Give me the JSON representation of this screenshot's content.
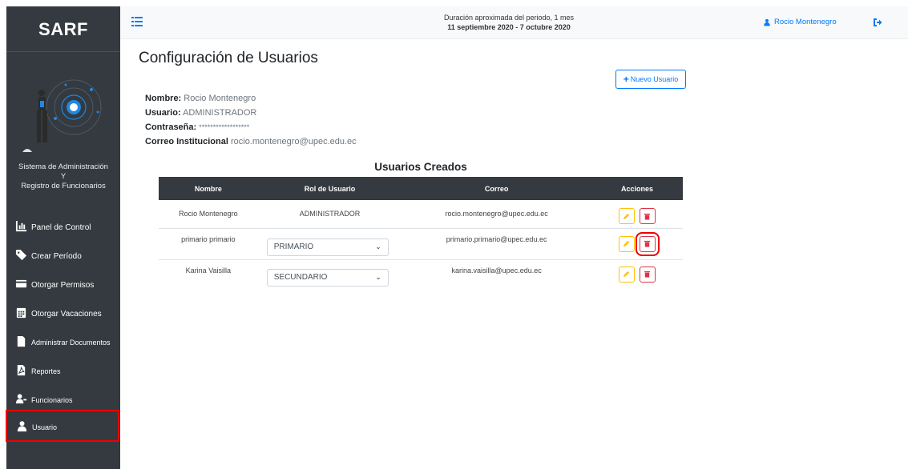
{
  "app": {
    "brand": "SARF",
    "system_name_line1": "Sistema de Administración",
    "system_name_line2": "Y",
    "system_name_line3": "Registro de Funcionarios"
  },
  "sidebar": {
    "items": [
      {
        "label": "Panel de Control",
        "icon": "chart-icon"
      },
      {
        "label": "Crear Período",
        "icon": "tag-icon"
      },
      {
        "label": "Otorgar Permisos",
        "icon": "id-card-icon"
      },
      {
        "label": "Otorgar Vacaciones",
        "icon": "calendar-icon"
      },
      {
        "label": "Administrar Documentos",
        "icon": "file-icon"
      },
      {
        "label": "Reportes",
        "icon": "pdf-file-icon"
      },
      {
        "label": "Funcionarios",
        "icon": "users-icon"
      },
      {
        "label": "Usuario",
        "icon": "user-icon"
      }
    ],
    "active_index": 7
  },
  "topbar": {
    "period_line1": "Duración aproximada del periodo, 1 mes",
    "period_line2": "11 septiembre 2020 - 7 octubre 2020",
    "user_name": "Rocio Montenegro"
  },
  "page": {
    "title": "Configuración de Usuarios",
    "new_user_label": "Nuevo Usuario",
    "info": {
      "name_label": "Nombre:",
      "name_value": "Rocio Montenegro",
      "user_label": "Usuario:",
      "user_value": "ADMINISTRADOR",
      "password_label": "Contraseña:",
      "password_value": "******************",
      "email_label": "Correo Institucional",
      "email_value": "rocio.montenegro@upec.edu.ec"
    },
    "table_title": "Usuarios Creados",
    "columns": [
      "Nombre",
      "Rol de Usuario",
      "Correo",
      "Acciones"
    ],
    "rows": [
      {
        "name": "Rocio Montenegro",
        "role": "ADMINISTRADOR",
        "email": "rocio.montenegro@upec.edu.ec"
      },
      {
        "name": "primario primario",
        "role": "PRIMARIO",
        "email": "primario.primario@upec.edu.ec"
      },
      {
        "name": "Karina Vaisilla",
        "role": "SECUNDARIO",
        "email": "karina.vaisilla@upec.edu.ec"
      }
    ]
  },
  "colors": {
    "sidebar": "#343a40",
    "accent": "#007bff",
    "edit": "#ffc107",
    "delete": "#dc3545",
    "highlight": "#ee0000"
  }
}
